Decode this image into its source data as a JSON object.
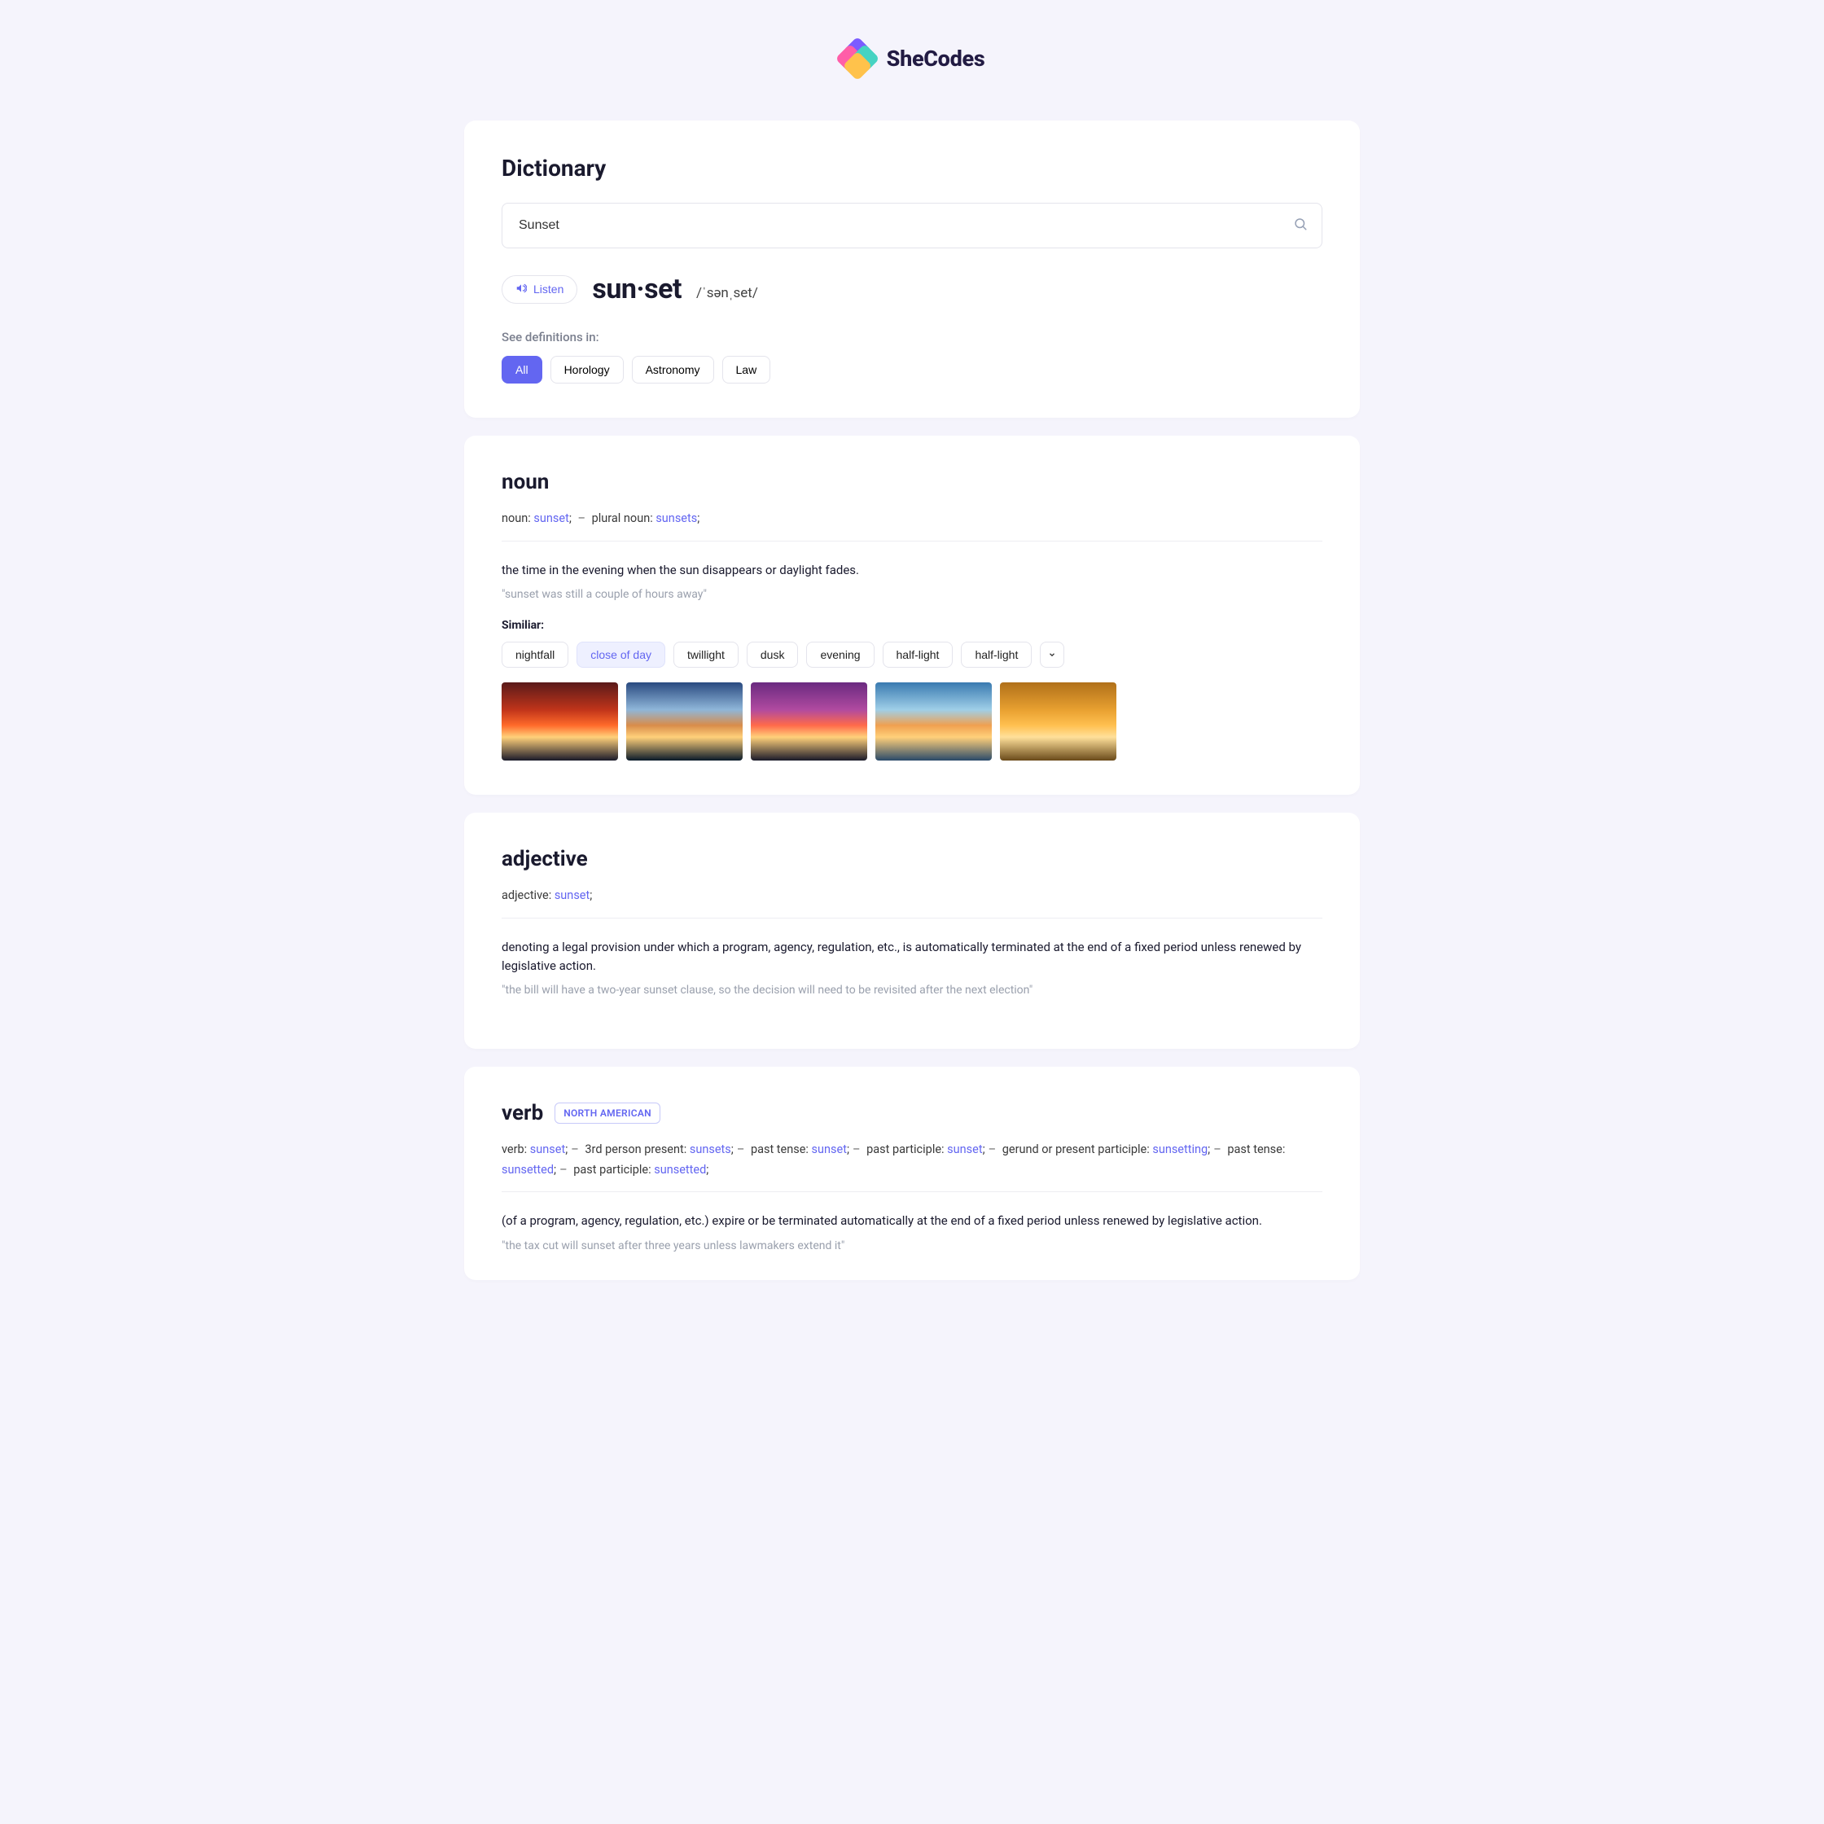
{
  "brand": "SheCodes",
  "header": {
    "title": "Dictionary",
    "search_value": "Sunset"
  },
  "word": {
    "listen_label": "Listen",
    "headword": "sun·set",
    "phonetic": "/ˈsənˌset/"
  },
  "see_in": {
    "label": "See definitions in:",
    "chips": [
      "All",
      "Horology",
      "Astronomy",
      "Law"
    ],
    "active": "All"
  },
  "noun": {
    "pos": "noun",
    "forms_prefix_a": "noun:",
    "forms_word_a": "sunset",
    "forms_sep_a": ";",
    "forms_dash": "–",
    "forms_prefix_b": "plural noun:",
    "forms_word_b": "sunsets",
    "forms_sep_b": ";",
    "definition": "the time in the evening when the sun disappears or daylight fades.",
    "example": "\"sunset was still a couple of hours away\"",
    "similar_label": "Similiar:",
    "similar": [
      "nightfall",
      "close of day",
      "twillight",
      "dusk",
      "evening",
      "half-light",
      "half-light"
    ],
    "similar_highlight": "close of day"
  },
  "adjective": {
    "pos": "adjective",
    "forms_prefix": "adjective:",
    "forms_word": "sunset",
    "forms_sep": ";",
    "definition": "denoting a legal provision under which a program, agency, regulation, etc., is automatically terminated at the end of a fixed period unless renewed by legislative action.",
    "example": "\"the bill will have a two-year sunset clause, so the decision will need to be revisited after the next election\""
  },
  "verb": {
    "pos": "verb",
    "region": "NORTH AMERICAN",
    "forms": [
      {
        "label": "verb:",
        "word": "sunset"
      },
      {
        "label": "3rd person present:",
        "word": "sunsets"
      },
      {
        "label": "past tense:",
        "word": "sunset"
      },
      {
        "label": "past participle:",
        "word": "sunset"
      },
      {
        "label": "gerund or present participle:",
        "word": "sunsetting"
      },
      {
        "label": "past tense:",
        "word": "sunsetted"
      },
      {
        "label": "past participle:",
        "word": "sunsetted"
      }
    ],
    "definition": "(of a program, agency, regulation, etc.) expire or be terminated automatically at the end of a fixed period unless renewed by legislative action.",
    "example": "\"the tax cut will sunset after three years unless lawmakers extend it\""
  }
}
